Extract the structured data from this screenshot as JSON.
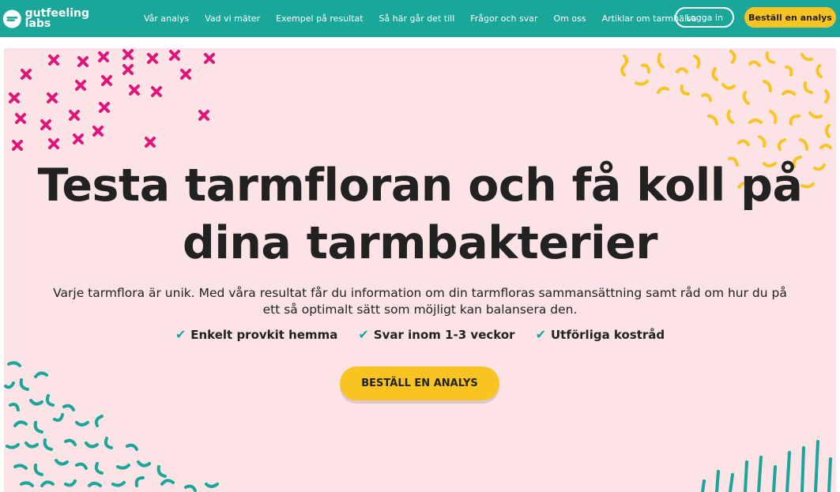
{
  "header": {
    "logo_line1": "gutfeeling",
    "logo_line2": "labs",
    "nav": [
      "Vår analys",
      "Vad vi mäter",
      "Exempel på resultat",
      "Så här går det till",
      "Frågor och svar",
      "Om oss",
      "Artiklar om tarmhälsa"
    ],
    "login_label": "Logga in",
    "order_label": "Beställ en analys"
  },
  "hero": {
    "headline_line1": "Testa tarmfloran och få koll på",
    "headline_line2": "dina tarmbakterier",
    "lead": "Varje tarmflora är unik. Med våra resultat får du information om din tarmfloras sammansättning samt råd om hur du på ett så optimalt sätt som möjligt kan balansera den.",
    "features": [
      "Enkelt provkit hemma",
      "Svar inom 1-3 veckor",
      "Utförliga kostråd"
    ],
    "cta_label": "BESTÄLL EN ANALYS"
  },
  "colors": {
    "header_bg": "#1aa698",
    "hero_bg": "#fce3e6",
    "accent_yellow": "#f9c422",
    "pattern_pink": "#e0157a",
    "pattern_teal": "#1aa698"
  },
  "icons": [
    "logo-mark-icon",
    "check-icon",
    "cross-pattern",
    "squiggle-pattern"
  ]
}
